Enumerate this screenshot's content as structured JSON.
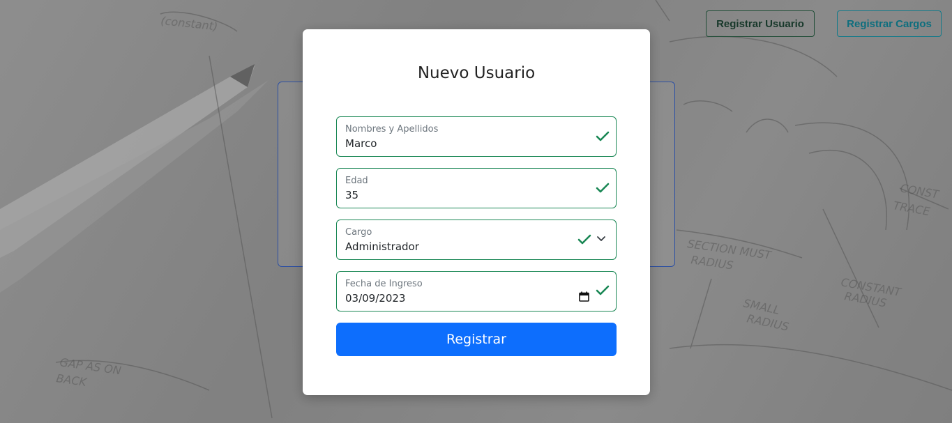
{
  "nav": {
    "register_user": "Registrar Usuario",
    "register_cargos": "Registrar Cargos"
  },
  "modal": {
    "title": "Nuevo Usuario",
    "fields": {
      "name": {
        "label": "Nombres y Apellidos",
        "value": "Marco"
      },
      "age": {
        "label": "Edad",
        "value": "35"
      },
      "cargo": {
        "label": "Cargo",
        "value": "Administrador"
      },
      "date": {
        "label": "Fecha de Ingreso",
        "value": "03/09/2023"
      }
    },
    "submit_label": "Registrar"
  },
  "colors": {
    "valid": "#198754",
    "primary": "#0d6efd"
  }
}
